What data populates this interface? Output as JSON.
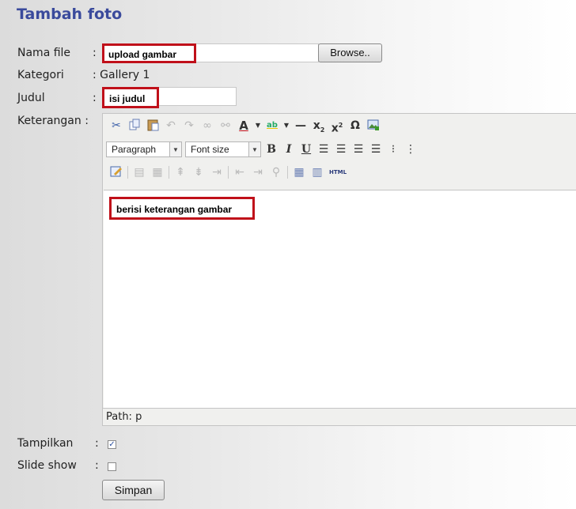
{
  "page": {
    "title": "Tambah foto"
  },
  "form": {
    "nama_file": {
      "label": "Nama file",
      "value": "upload gambar",
      "browse_label": "Browse.."
    },
    "kategori": {
      "label": "Kategori",
      "value": ": Gallery 1"
    },
    "judul": {
      "label": "Judul",
      "value": "isi judul"
    },
    "keterangan": {
      "label": "Keterangan :",
      "content": "berisi keterangan gambar"
    },
    "tampilkan": {
      "label": "Tampilkan",
      "checked": true
    },
    "slide_show": {
      "label": "Slide show",
      "checked": false
    },
    "submit_label": "Simpan"
  },
  "colon": ":",
  "editor": {
    "format_select": "Paragraph",
    "fontsize_select": "Font size",
    "status_path": "Path: p",
    "icons": [
      "cut-icon",
      "copy-icon",
      "paste-icon",
      "undo-icon",
      "redo-icon",
      "link-icon",
      "unlink-icon",
      "text-color-icon",
      "highlight-color-icon",
      "horizontal-rule-icon",
      "subscript-icon",
      "superscript-icon",
      "special-char-icon",
      "insert-image-icon",
      "bold-icon",
      "italic-icon",
      "underline-icon",
      "align-left-icon",
      "align-center-icon",
      "align-right-icon",
      "align-justify-icon",
      "bullet-list-icon",
      "numbered-list-icon",
      "edit-icon",
      "table-icon",
      "html-icon"
    ],
    "html_label": "HTML"
  },
  "colors": {
    "title": "#3a4a9c",
    "highlight_border": "#c0101a"
  }
}
